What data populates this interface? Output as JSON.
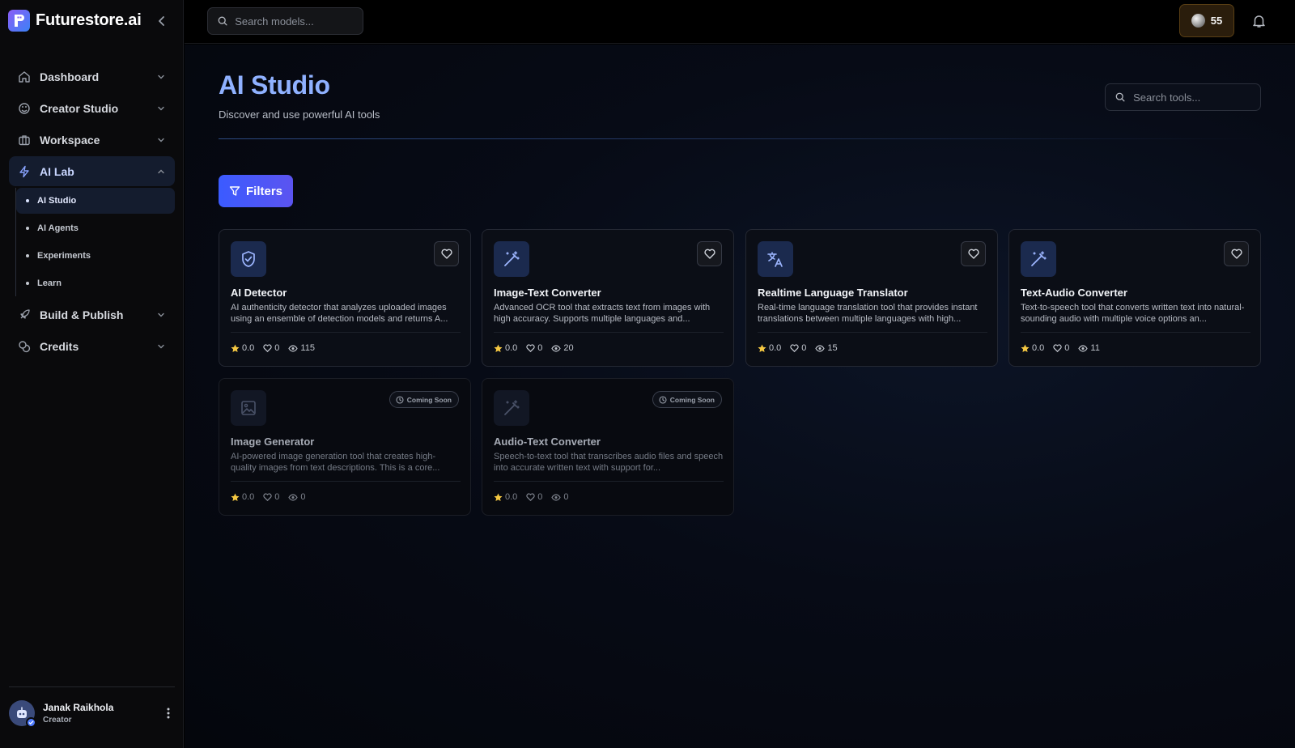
{
  "brand": {
    "name": "Futurestore.ai"
  },
  "top": {
    "search_placeholder": "Search models...",
    "credits": "55"
  },
  "sidebar": {
    "items": [
      {
        "label": "Dashboard",
        "icon": "home-icon",
        "expanded": false
      },
      {
        "label": "Creator Studio",
        "icon": "palette-icon",
        "expanded": false
      },
      {
        "label": "Workspace",
        "icon": "briefcase-icon",
        "expanded": false
      },
      {
        "label": "AI Lab",
        "icon": "lightning-icon",
        "expanded": true,
        "active": true
      },
      {
        "label": "Build & Publish",
        "icon": "rocket-icon",
        "expanded": false
      },
      {
        "label": "Credits",
        "icon": "coins-icon",
        "expanded": false
      }
    ],
    "ai_lab_children": [
      {
        "label": "AI Studio",
        "active": true
      },
      {
        "label": "AI Agents"
      },
      {
        "label": "Experiments"
      },
      {
        "label": "Learn"
      }
    ]
  },
  "user": {
    "name": "Janak Raikhola",
    "role": "Creator"
  },
  "main": {
    "title": "AI Studio",
    "subtitle": "Discover and use powerful AI tools",
    "search_placeholder": "Search tools...",
    "filters_label": "Filters"
  },
  "tools": [
    {
      "name": "AI Detector",
      "description": "AI authenticity detector that analyzes uploaded images using an ensemble of detection models and returns A...",
      "icon": "shield-check-icon",
      "rating": "0.0",
      "likes": "0",
      "views": "115",
      "coming_soon": false
    },
    {
      "name": "Image-Text Converter",
      "description": "Advanced OCR tool that extracts text from images with high accuracy. Supports multiple languages and...",
      "icon": "magic-wand-icon",
      "rating": "0.0",
      "likes": "0",
      "views": "20",
      "coming_soon": false
    },
    {
      "name": "Realtime Language Translator",
      "description": "Real-time language translation tool that provides instant translations between multiple languages with high...",
      "icon": "translate-icon",
      "rating": "0.0",
      "likes": "0",
      "views": "15",
      "coming_soon": false
    },
    {
      "name": "Text-Audio Converter",
      "description": "Text-to-speech tool that converts written text into natural-sounding audio with multiple voice options an...",
      "icon": "magic-wand-icon",
      "rating": "0.0",
      "likes": "0",
      "views": "11",
      "coming_soon": false
    },
    {
      "name": "Image Generator",
      "description": "AI-powered image generation tool that creates high-quality images from text descriptions. This is a core...",
      "icon": "image-icon",
      "rating": "0.0",
      "likes": "0",
      "views": "0",
      "coming_soon": true,
      "badge": "Coming Soon"
    },
    {
      "name": "Audio-Text Converter",
      "description": "Speech-to-text tool that transcribes audio files and speech into accurate written text with support for...",
      "icon": "magic-wand-icon",
      "rating": "0.0",
      "likes": "0",
      "views": "0",
      "coming_soon": true,
      "badge": "Coming Soon"
    }
  ],
  "colors": {
    "accent": "#8fb1ff",
    "filters_button": "#3b5bff",
    "active_nav_bg": "#141c2e",
    "credits_pill_bg": "#2a1d0c",
    "star": "#f5c842"
  }
}
